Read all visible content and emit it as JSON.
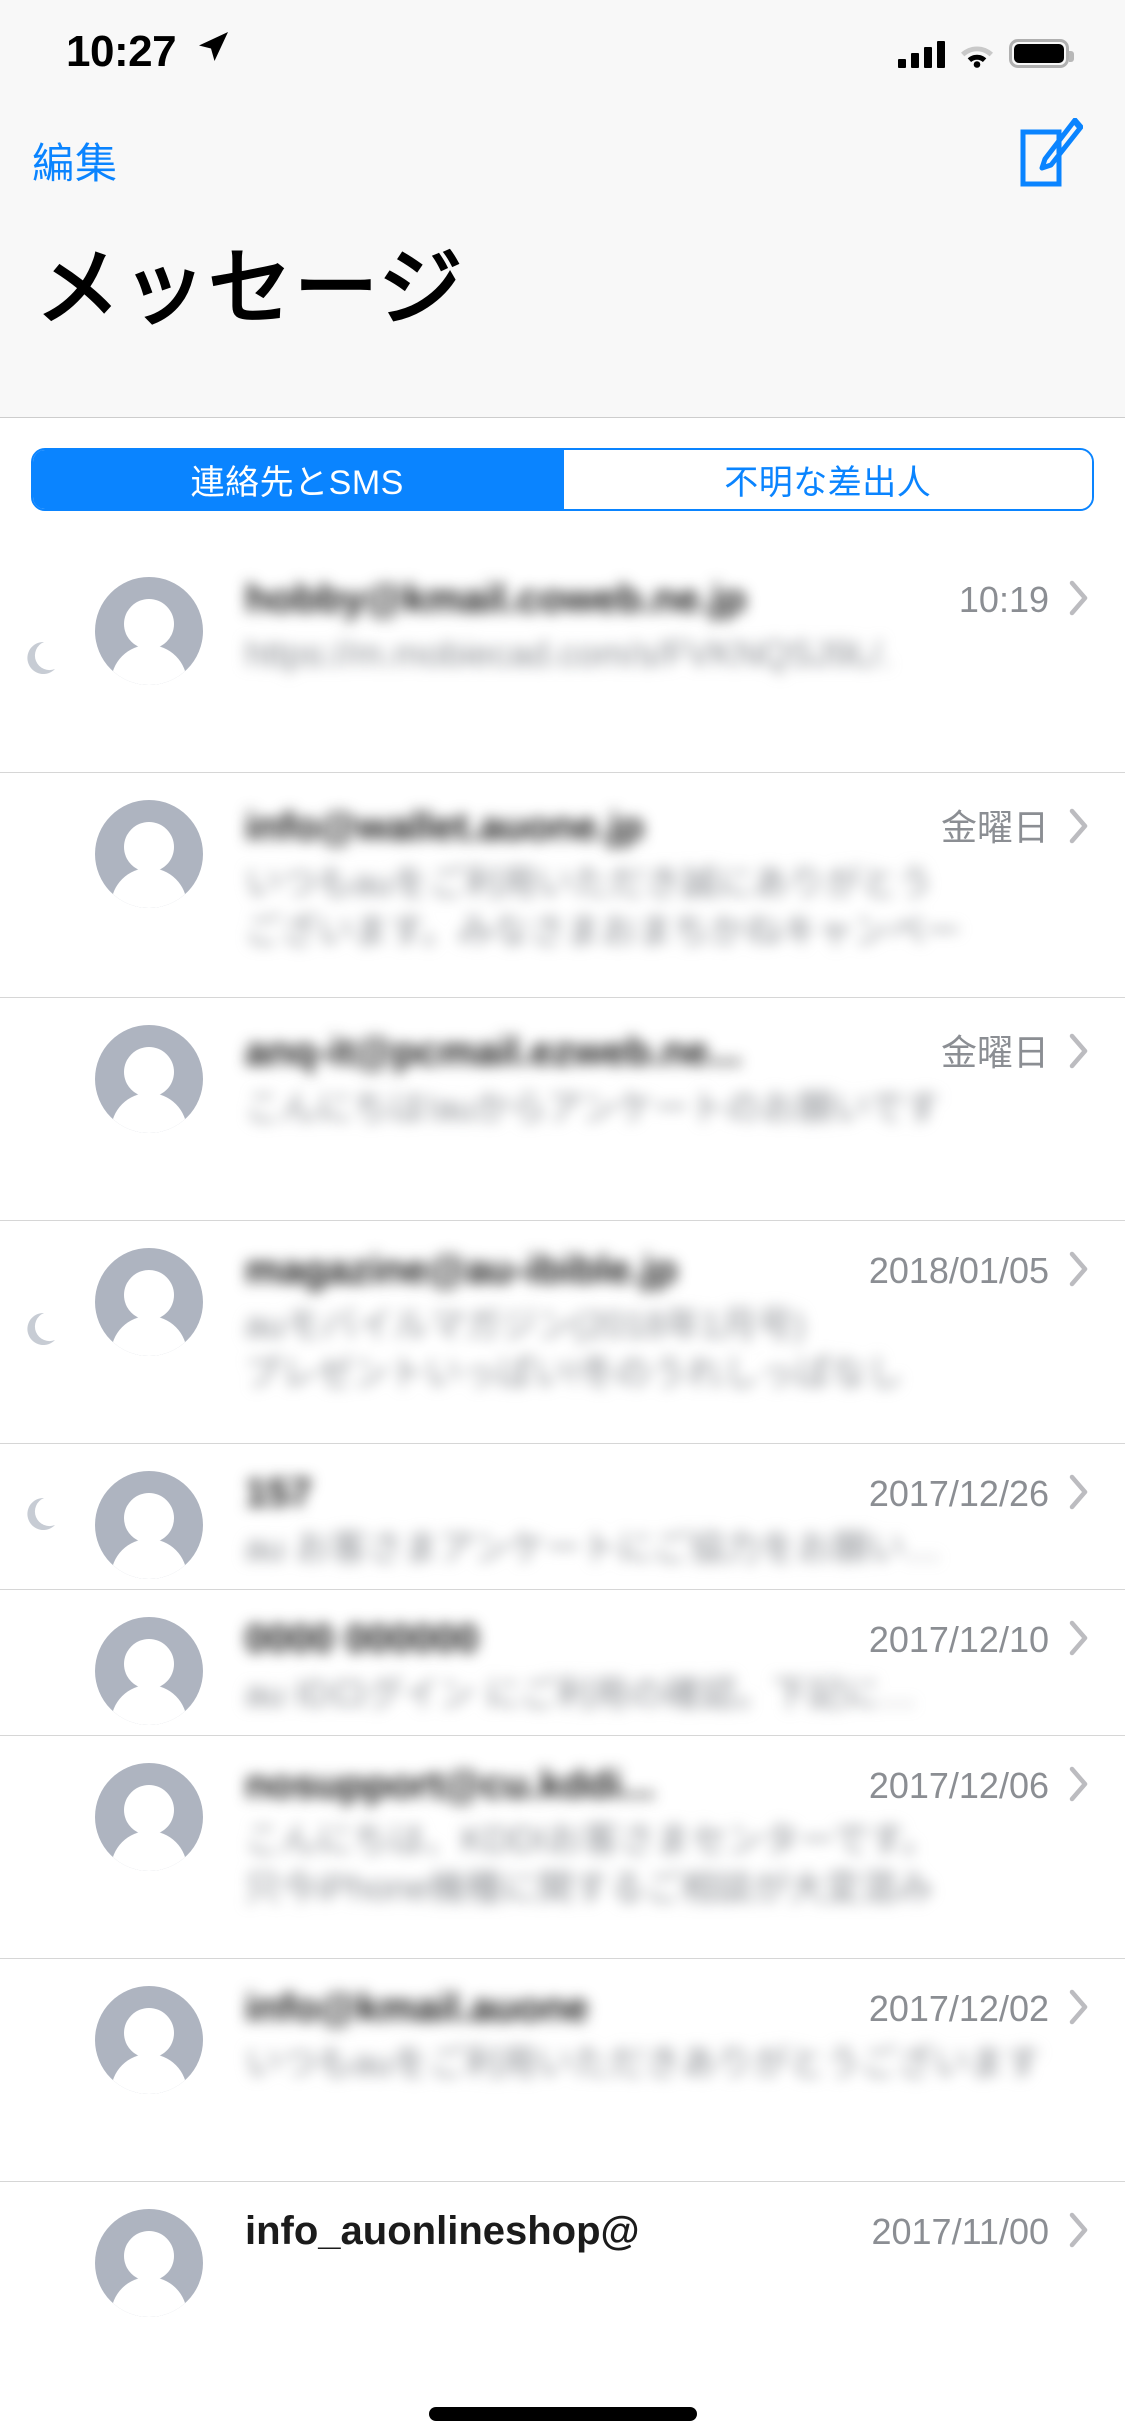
{
  "status_bar": {
    "time": "10:27",
    "location_icon": "location-arrow-icon",
    "signal_icon": "cellular-signal-icon",
    "wifi_icon": "wifi-icon",
    "battery_icon": "battery-full-icon"
  },
  "nav": {
    "edit_label": "編集",
    "compose_icon": "compose-message-icon",
    "title": "メッセージ"
  },
  "segmented_control": {
    "accent_color": "#0a84ff",
    "selected_index": 0,
    "segments": [
      {
        "label": "連絡先とSMS"
      },
      {
        "label": "不明な差出人"
      }
    ]
  },
  "conversations": [
    {
      "sender": "hobby@kmail.coweb.ne.jp",
      "preview_lines": [
        "https://m.mobiecad.com/s/FVKNQSJ9L/."
      ],
      "timestamp": "10:19",
      "muted": true,
      "redacted": true
    },
    {
      "sender": "info@wallet.auone.jp",
      "preview_lines": [
        "いつもauをご利用いただき誠にありがとう",
        "ございます。みなさまおまちかねキャンペー"
      ],
      "timestamp": "金曜日",
      "muted": false,
      "redacted": true
    },
    {
      "sender": "anq-it@pcmail.ezweb.ne...",
      "preview_lines": [
        "こんにちは!auからアンケートのお願いです"
      ],
      "timestamp": "金曜日",
      "muted": false,
      "redacted": true
    },
    {
      "sender": "magazine@au-ibible.jp",
      "preview_lines": [
        "auモバイルマガジン(2018年1月号)",
        "プレゼントいっぱい!冬のうれしっぱなし"
      ],
      "timestamp": "2018/01/05",
      "muted": true,
      "redacted": true
    },
    {
      "sender": "157",
      "preview_lines": [
        "au お客さまアンケートにご協力をお願い…"
      ],
      "timestamp": "2017/12/26",
      "muted": true,
      "redacted": true
    },
    {
      "sender": "0000 000000",
      "preview_lines": [
        "au IDログイン にご利用の確認。下記に…"
      ],
      "timestamp": "2017/12/10",
      "muted": false,
      "redacted": true
    },
    {
      "sender": "nosupport@cu.kddi...",
      "preview_lines": [
        "こんにちは、KDDIお客さまセンターです。",
        "只今iPhone機種に関するご相談が大変混み"
      ],
      "timestamp": "2017/12/06",
      "muted": false,
      "redacted": true
    },
    {
      "sender": "info@kmail.auone",
      "preview_lines": [
        "いつもauをご利用いただきありがとうございます"
      ],
      "timestamp": "2017/12/02",
      "muted": false,
      "redacted": true
    },
    {
      "sender": "info_auonlineshop@",
      "preview_lines": [],
      "timestamp": "2017/11/00",
      "muted": false,
      "redacted": false
    }
  ]
}
